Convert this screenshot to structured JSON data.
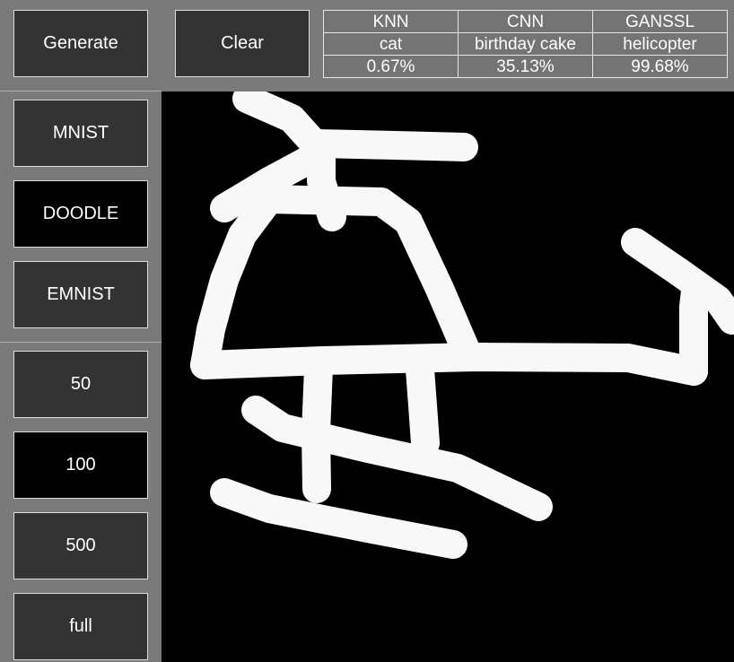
{
  "toolbar": {
    "generate_label": "Generate",
    "clear_label": "Clear"
  },
  "results": {
    "headers": [
      "KNN",
      "CNN",
      "GANSSL"
    ],
    "predictions": [
      "cat",
      "birthday cake",
      "helicopter"
    ],
    "confidences": [
      "0.67%",
      "35.13%",
      "99.68%"
    ]
  },
  "datasets": {
    "items": [
      {
        "label": "MNIST",
        "active": false
      },
      {
        "label": "DOODLE",
        "active": true
      },
      {
        "label": "EMNIST",
        "active": false
      }
    ]
  },
  "sizes": {
    "items": [
      {
        "label": "50",
        "active": false
      },
      {
        "label": "100",
        "active": true
      },
      {
        "label": "500",
        "active": false
      },
      {
        "label": "full",
        "active": false
      }
    ]
  },
  "colors": {
    "background": "#7a7a7a",
    "button": "#333333",
    "button_active": "#000000",
    "canvas": "#000000",
    "stroke": "#f8f8f8"
  }
}
